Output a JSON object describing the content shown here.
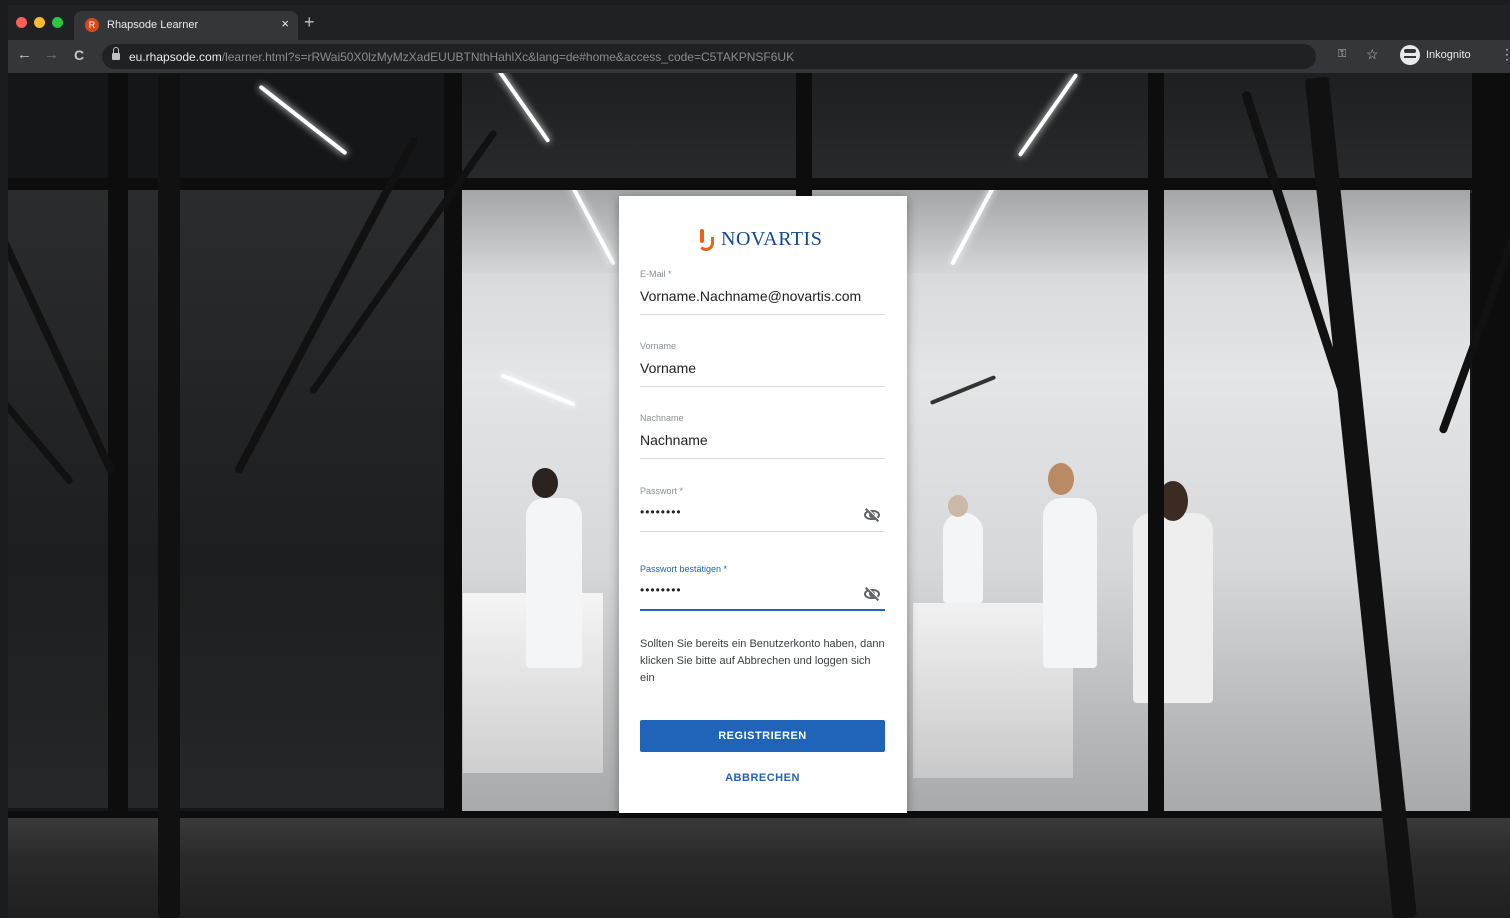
{
  "browser": {
    "tab_title": "Rhapsode Learner",
    "tab_close": "×",
    "new_tab": "+",
    "url_host": "eu.rhapsode.com",
    "url_path": "/learner.html?s=rRWai50X0lzMyMzXadEUUBTNthHahlXc&lang=de#home&access_code=C5TAKPNSF6UK",
    "profile_label": "Inkognito",
    "back": "←",
    "forward": "→",
    "reload": "C",
    "key": "⚿",
    "star": "☆",
    "menu": "⋮",
    "colors": {
      "close": "#ff5f57",
      "minimize": "#febc2e",
      "zoom": "#28c840"
    }
  },
  "form": {
    "brand": "NOVARTIS",
    "email": {
      "label": "E-Mail *",
      "value": "Vorname.Nachname@novartis.com"
    },
    "first_name": {
      "label": "Vorname",
      "value": "Vorname"
    },
    "last_name": {
      "label": "Nachname",
      "value": "Nachname"
    },
    "password": {
      "label": "Passwort *",
      "value": "••••••••"
    },
    "password_confirm": {
      "label": "Passwort bestätigen *",
      "value": "••••••••"
    },
    "info_text": "Sollten Sie bereits ein Benutzerkonto haben, dann klicken Sie bitte auf Abbrechen und loggen sich ein",
    "register_label": "REGISTRIEREN",
    "cancel_label": "ABBRECHEN",
    "colors": {
      "primary": "#1f64b8",
      "brand_blue": "#0f4b8f",
      "brand_orange": "#e8621c"
    }
  }
}
